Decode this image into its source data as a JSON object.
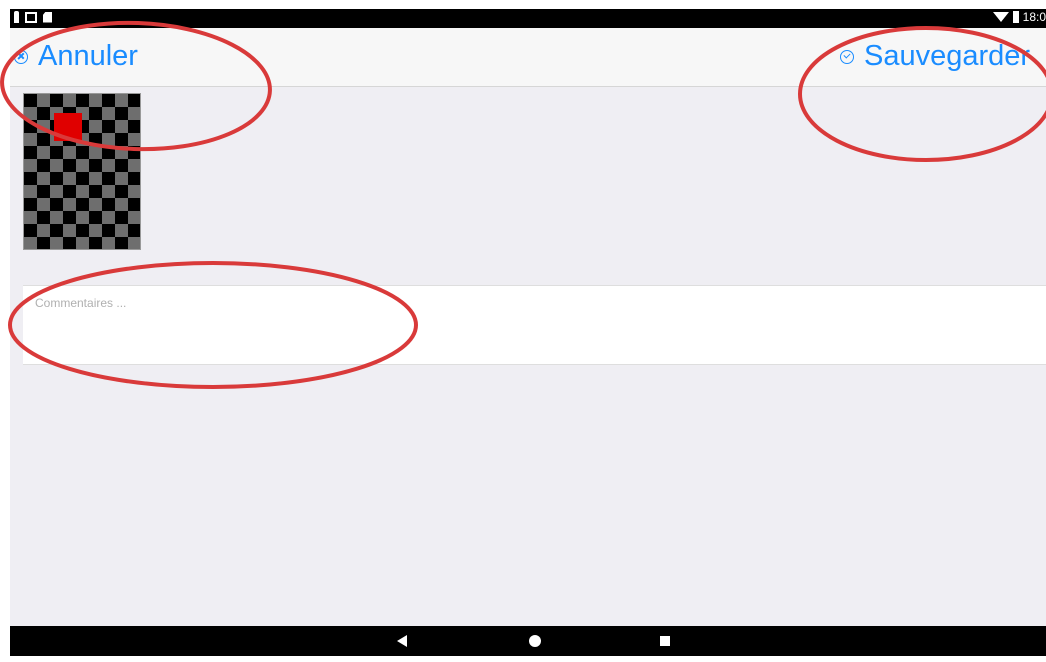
{
  "status_bar": {
    "time": "18:0"
  },
  "header": {
    "cancel_label": "Annuler",
    "save_label": "Sauvegarder"
  },
  "comment": {
    "placeholder": "Commentaires ...",
    "value": ""
  },
  "colors": {
    "accent": "#1a8cff",
    "background": "#efeef3",
    "annotation": "#d93a3a"
  }
}
